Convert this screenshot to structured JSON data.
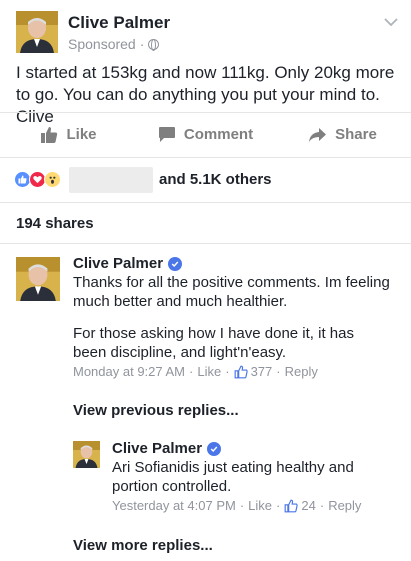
{
  "post": {
    "author": "Clive Palmer",
    "sponsored": "Sponsored",
    "separator": "·",
    "text": "I started at 153kg and now 111kg. Only 20kg more to go. You can do anything you put your mind to. Clive"
  },
  "actions": {
    "like": "Like",
    "comment": "Comment",
    "share": "Share"
  },
  "reactions": {
    "types": [
      "like",
      "love",
      "wow"
    ],
    "others": "and 5.1K others"
  },
  "shares": "194 shares",
  "comments": [
    {
      "author": "Clive Palmer",
      "verified": true,
      "text_p1": "Thanks for all the positive comments. Im feeling much better and much healthier.",
      "text_p2": "For those asking how I have done it, it has been discipline, and light'n'easy.",
      "time": "Monday at 9:27 AM",
      "like_label": "Like",
      "likes": "377",
      "reply_label": "Reply"
    }
  ],
  "view_previous": "View previous replies...",
  "reply": {
    "author": "Clive Palmer",
    "verified": true,
    "text": "Ari Sofianidis just eating healthy and portion controlled.",
    "time": "Yesterday at 4:07 PM",
    "like_label": "Like",
    "likes": "24",
    "reply_label": "Reply"
  },
  "view_more": "View more replies...",
  "colors": {
    "text": "#1d2129",
    "meta": "#90949c",
    "action": "#7f7f7f",
    "like_blue": "#5890ff",
    "love_red": "#f0284a",
    "wow_yellow": "#ffd972",
    "verified_blue": "#4a76e8",
    "avatar_bg": "#c9a23d"
  }
}
